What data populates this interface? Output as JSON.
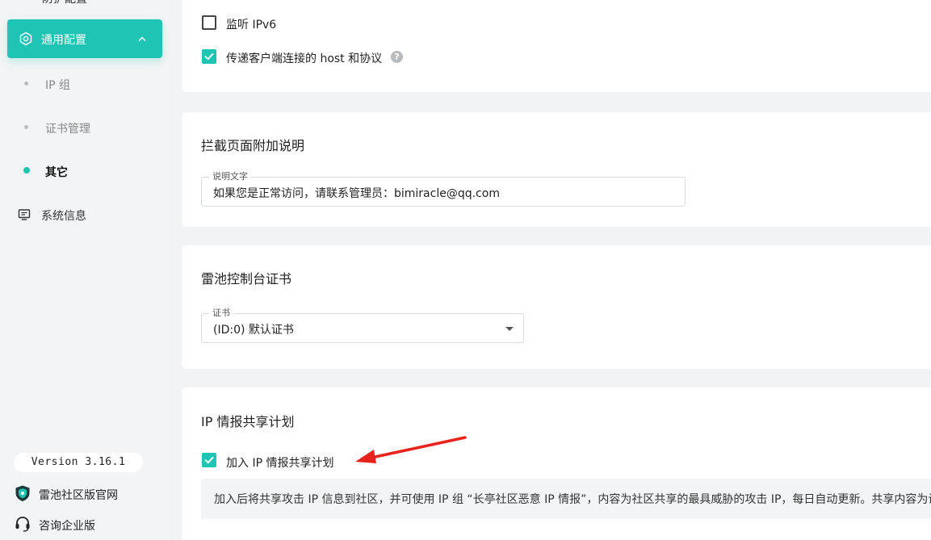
{
  "sidebar": {
    "top_cut_label": "防护配置",
    "active_item": {
      "label": "通用配置",
      "icon": "gear-icon"
    },
    "sub_items": [
      {
        "label": "IP 组"
      },
      {
        "label": "证书管理"
      },
      {
        "label": "其它",
        "active": true
      }
    ],
    "system_info": {
      "label": "系统信息",
      "icon": "monitor-icon"
    },
    "version": "Version 3.16.1",
    "community_link": "雷池社区版官网",
    "enterprise_link": "咨询企业版"
  },
  "listen_card": {
    "ipv6_label": "监听 IPv6",
    "ipv6_checked": false,
    "pass_host_label": "传递客户端连接的 host 和协议",
    "pass_host_checked": true,
    "help_glyph": "?"
  },
  "intercept_card": {
    "title": "拦截页面附加说明",
    "field_legend": "说明文字",
    "field_value": "如果您是正常访问，请联系管理员：bimiracle@qq.com"
  },
  "cert_card": {
    "title": "雷池控制台证书",
    "field_legend": "证书",
    "selected": "(ID:0) 默认证书"
  },
  "ip_share_card": {
    "title": "IP 情报共享计划",
    "join_label": "加入 IP 情报共享计划",
    "join_checked": true,
    "description": "加入后将共享攻击 IP 信息到社区，并可使用 IP 组 “长亭社区恶意 IP 情报”，内容为社区共享的最具威胁的攻击 IP，每日自动更新。共享内容为设"
  },
  "colors": {
    "accent": "#20c4b4",
    "arrow": "#e8231e"
  }
}
